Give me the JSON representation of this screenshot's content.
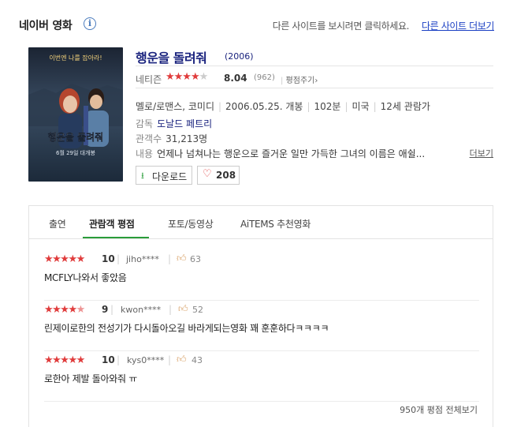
{
  "header": {
    "brand": "네이버 영화",
    "info_icon": "info-icon",
    "other_site_text": "다른 사이트를 보시려면 클릭하세요.",
    "other_site_link": "다른 사이트 더보기"
  },
  "poster": {
    "top_caption": "이번엔 나를 잡아라!",
    "title_art": "행운을 돌려줘",
    "release_caption": "6월 29일 대개봉"
  },
  "movie": {
    "title": "행운을 돌려줘",
    "year": "(2006)",
    "rating_label": "네티즌",
    "score": "8.04",
    "score_fraction": 0.804,
    "rating_count": "(962)",
    "rate_button": "평점주기",
    "genre": "멜로/로맨스, 코미디",
    "release_date": "2006.05.25. 개봉",
    "runtime": "102분",
    "country": "미국",
    "age": "12세 관람가",
    "director_label": "감독",
    "director": "도날드 페트리",
    "audience_label": "관객수",
    "audience": "31,213명",
    "synopsis_label": "내용",
    "synopsis": "언제나 넘쳐나는 행운으로 즐거운 일만 가득한 그녀의 이름은 애쉴...",
    "more_link": "더보기"
  },
  "actions": {
    "download_label": "다운로드",
    "like_count": "208"
  },
  "tabs": [
    {
      "label": "출연"
    },
    {
      "label": "관람객 평점"
    },
    {
      "label": "포토/동영상"
    },
    {
      "label": "AiTEMS 추천영화"
    }
  ],
  "reviews": [
    {
      "stars": "★★★★★",
      "stars_off": "",
      "score": "10",
      "user": "jiho****",
      "likes": "63",
      "text": "MCFLY나와서 좋았음"
    },
    {
      "stars": "★★★★",
      "stars_half": "★",
      "stars_off": "",
      "score": "9",
      "user": "kwon****",
      "likes": "52",
      "text": "린제이로한의 전성기가 다시돌아오길 바라게되는영화 꽤 훈훈하다ㅋㅋㅋㅋ"
    },
    {
      "stars": "★★★★★",
      "stars_off": "",
      "score": "10",
      "user": "kys0****",
      "likes": "43",
      "text": "로한아 제발 돌아와줘 ㅠ"
    }
  ],
  "footer": {
    "all_reviews_link": "950개 평점 전체보기"
  },
  "colors": {
    "title": "#1a237e",
    "star": "#e03c3c",
    "accent_green": "#2a9d3a",
    "link_blue": "#1a3fc3"
  }
}
